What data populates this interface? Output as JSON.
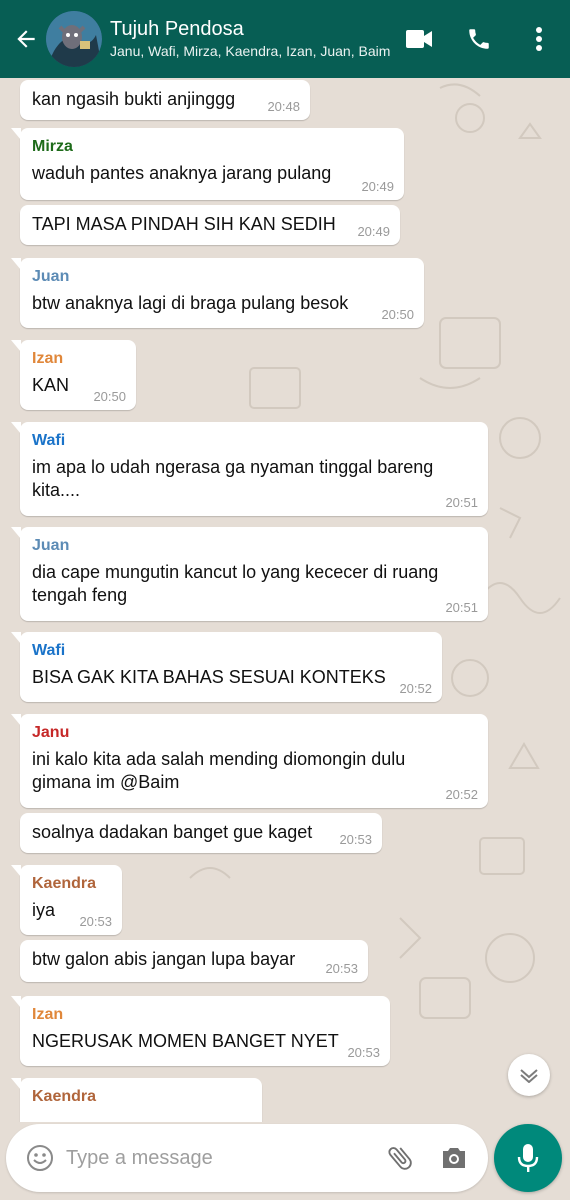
{
  "header": {
    "title": "Tujuh Pendosa",
    "subtitle": "Janu, Wafi, Mirza, Kaendra, Izan, Juan, Baim",
    "icons": [
      "back-arrow-icon",
      "video-call-icon",
      "voice-call-icon",
      "more-vert-icon"
    ]
  },
  "colors": {
    "header_bg": "#075e54",
    "chat_bg": "#e5ddd5",
    "mic_button": "#00897b",
    "sender_mirza": "#1e6b1a",
    "sender_juan": "#5c8bb5",
    "sender_izan": "#e0873a",
    "sender_wafi": "#1a73c9",
    "sender_janu": "#c62828",
    "sender_kaendra": "#b0653b"
  },
  "messages": [
    {
      "sender": "",
      "text": "kan ngasih bukti anjinggg",
      "time": "20:48"
    },
    {
      "sender": "Mirza",
      "text": "waduh pantes anaknya jarang pulang",
      "time": "20:49"
    },
    {
      "sender": "",
      "text": "TAPI MASA PINDAH SIH KAN SEDIH",
      "time": "20:49"
    },
    {
      "sender": "Juan",
      "text": "btw anaknya lagi di braga pulang besok",
      "time": "20:50"
    },
    {
      "sender": "Izan",
      "text": "KAN",
      "time": "20:50"
    },
    {
      "sender": "Wafi",
      "text": "im apa lo udah ngerasa ga nyaman tinggal bareng kita....",
      "time": "20:51"
    },
    {
      "sender": "Juan",
      "text": "dia cape mungutin kancut lo yang kececer di ruang tengah feng",
      "time": "20:51"
    },
    {
      "sender": "Wafi",
      "text": "BISA GAK KITA BAHAS SESUAI KONTEKS",
      "time": "20:52"
    },
    {
      "sender": "Janu",
      "text": "ini kalo kita ada salah mending diomongin dulu gimana im @Baim",
      "time": "20:52"
    },
    {
      "sender": "",
      "text": "soalnya dadakan banget gue kaget",
      "time": "20:53"
    },
    {
      "sender": "Kaendra",
      "text": "iya",
      "time": "20:53"
    },
    {
      "sender": "",
      "text": "btw galon abis jangan lupa bayar",
      "time": "20:53"
    },
    {
      "sender": "Izan",
      "text": "NGERUSAK MOMEN BANGET NYET",
      "time": "20:53"
    },
    {
      "sender": "Kaendra",
      "text": "",
      "time": ""
    }
  ],
  "input": {
    "placeholder": "Type a message",
    "icons": [
      "emoji-icon",
      "attach-icon",
      "camera-icon",
      "mic-icon"
    ]
  },
  "scroll_icon": "scroll-down-icon"
}
